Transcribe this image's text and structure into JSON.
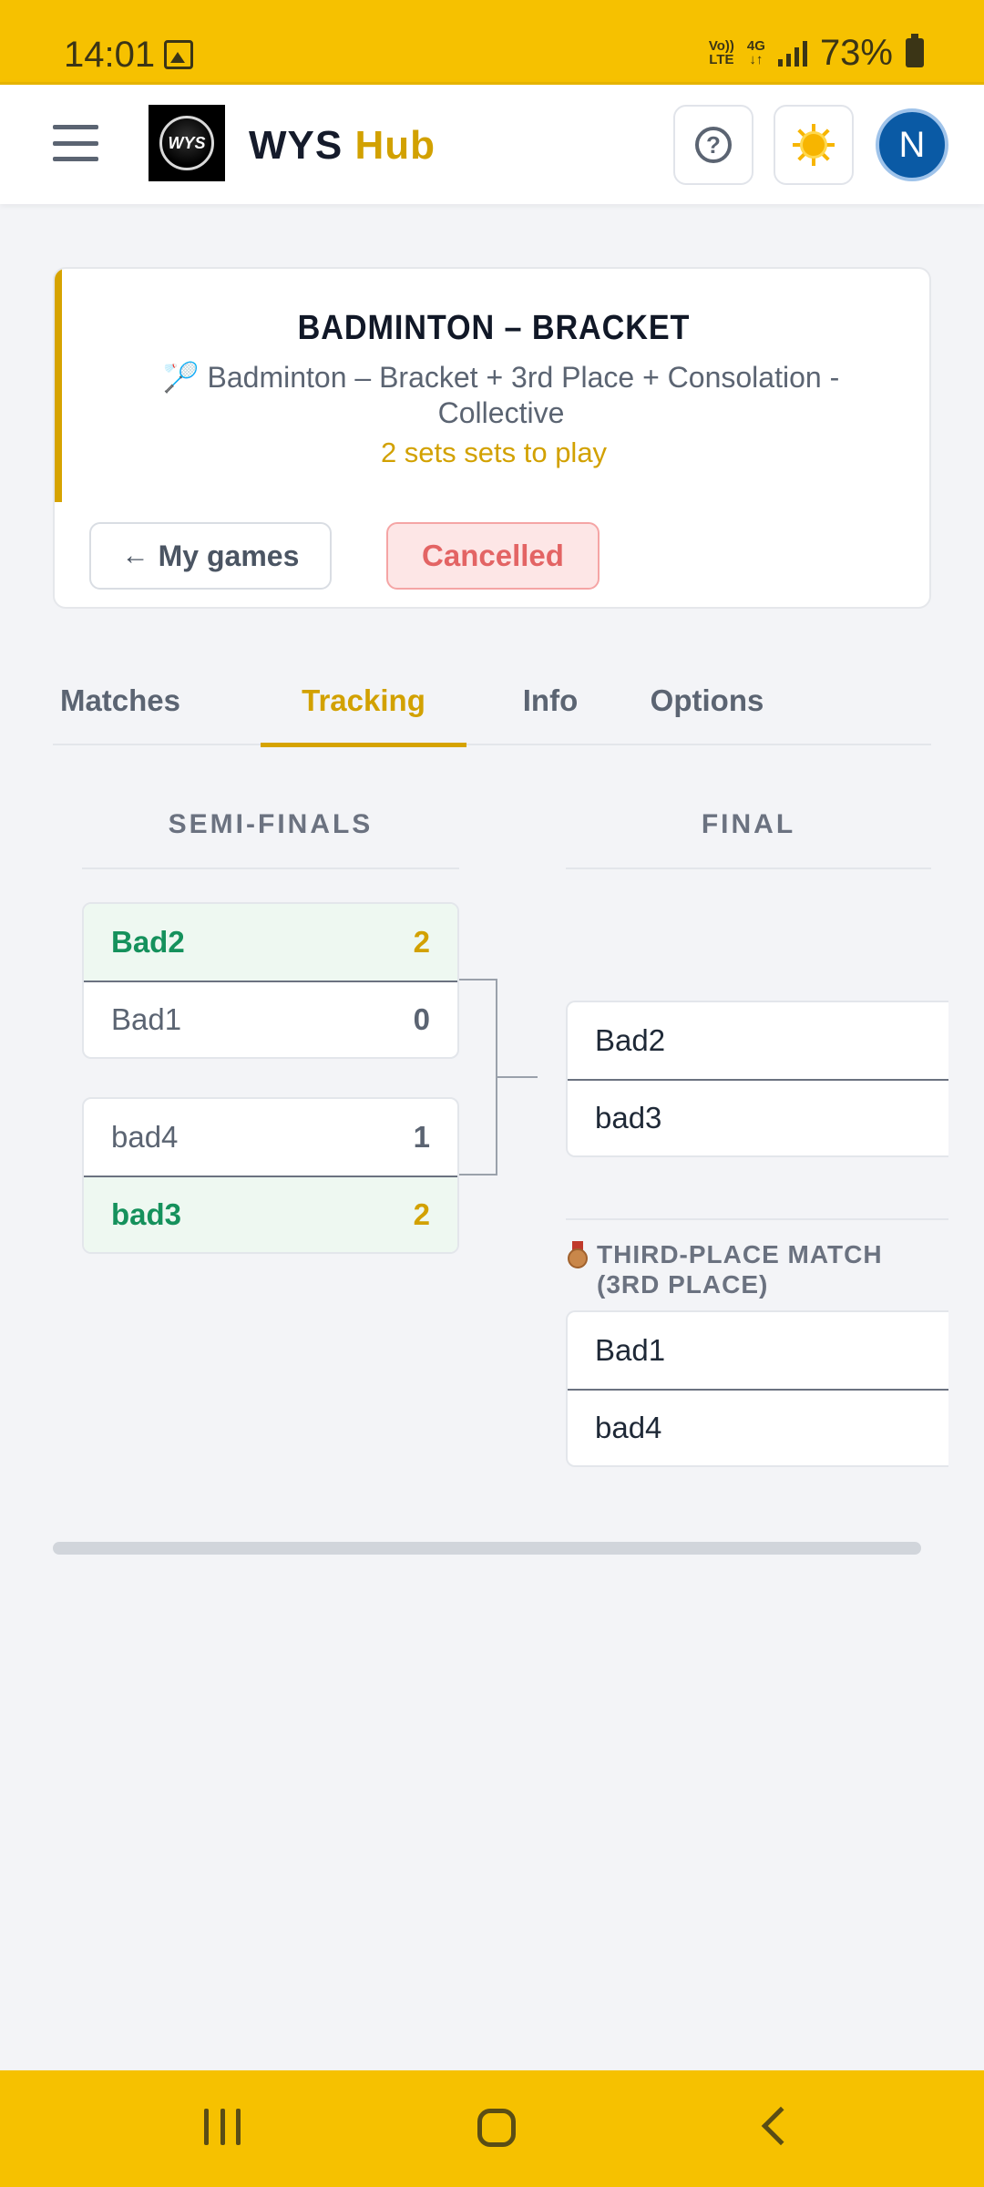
{
  "status_bar": {
    "time": "14:01",
    "volte": "Vo))\nLTE",
    "network": "4G",
    "battery": "73%"
  },
  "header": {
    "logo_text": "WYS",
    "brand_main": "WYS",
    "brand_accent": "Hub",
    "avatar_initial": "N"
  },
  "game": {
    "title": "BADMINTON – BRACKET",
    "subtitle": "🏸 Badminton – Bracket + 3rd Place + Consolation - Collective",
    "sets_info": "2 sets sets to play",
    "back_label": "My games",
    "back_arrow": "←",
    "status_label": "Cancelled"
  },
  "tabs": [
    {
      "label": "Matches"
    },
    {
      "label": "Tracking",
      "active": true
    },
    {
      "label": "Info"
    },
    {
      "label": "Options"
    }
  ],
  "bracket": {
    "rounds": [
      "SEMI-FINALS",
      "FINAL"
    ],
    "semi_finals": [
      {
        "teams": [
          {
            "name": "Bad2",
            "score": "2",
            "winner": true
          },
          {
            "name": "Bad1",
            "score": "0",
            "winner": false
          }
        ]
      },
      {
        "teams": [
          {
            "name": "bad4",
            "score": "1",
            "winner": false
          },
          {
            "name": "bad3",
            "score": "2",
            "winner": true
          }
        ]
      }
    ],
    "final": {
      "teams": [
        {
          "name": "Bad2"
        },
        {
          "name": "bad3"
        }
      ]
    },
    "third_place_label": "THIRD-PLACE MATCH (3RD PLACE)",
    "third_place": {
      "teams": [
        {
          "name": "Bad1"
        },
        {
          "name": "bad4"
        }
      ]
    }
  },
  "colors": {
    "brand_yellow": "#f6c100",
    "accent_gold": "#d2a100",
    "winner_green": "#15915c",
    "cancel_red": "#e36464",
    "avatar_blue": "#0a5aa5"
  }
}
